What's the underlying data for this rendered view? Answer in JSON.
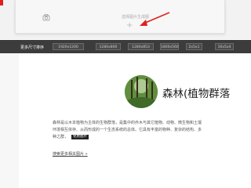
{
  "upload_popup": {
    "hint": "选择图片生成图",
    "plus_symbol": "+",
    "arrow_color": "#e02020"
  },
  "size_bar": {
    "more_label": "更多尺寸排序",
    "sizes": [
      "1920x1200",
      "1280x800",
      "1280x853",
      "1800x560",
      "2x5x1",
      "16x5x4"
    ]
  },
  "article": {
    "title": "森林(植物群落",
    "lines": [
      "森林是以木本植物为主体的生物群落，是集中的乔木与其它植物、动物、微生物和土壤",
      "环境相互依存、从而形成的一个生态系统的总体。它具有丰富的物种、复杂的结构、多",
      "种之群，"
    ],
    "tag": "免费图片",
    "more_link": "搜索更多相关图片 »"
  },
  "colors": {
    "accent_red": "#e02020",
    "size_bar_bg": "#3c3c3c"
  }
}
